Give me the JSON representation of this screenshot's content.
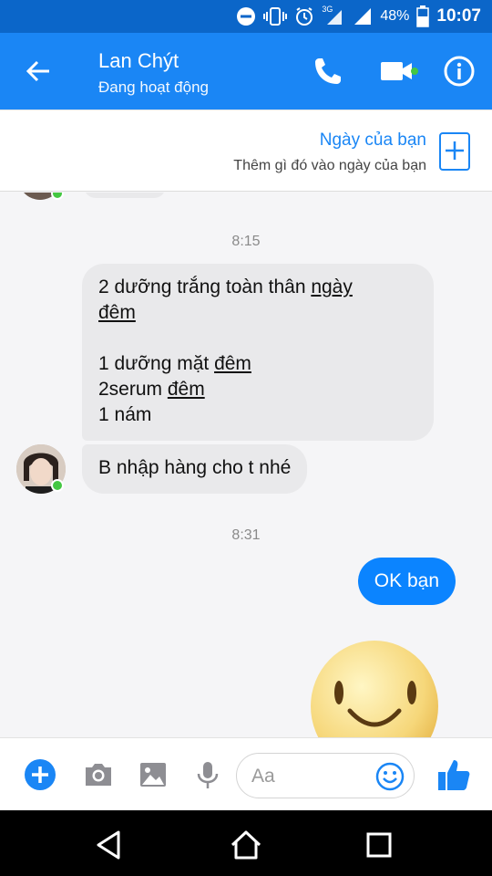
{
  "status_bar": {
    "network_label": "3G",
    "battery": "48%",
    "time": "10:07"
  },
  "header": {
    "contact_name": "Lan Chýt",
    "contact_status": "Đang hoạt động"
  },
  "your_day": {
    "title": "Ngày của bạn",
    "subtitle": "Thêm gì đó vào ngày của bạn"
  },
  "conversation": {
    "timestamp_1": "8:15",
    "message_1": {
      "line1_part1": "2 dưỡng trắng toàn thân ",
      "line1_link": "ngày",
      "line2_link": "đêm",
      "line3_part1": "1 dưỡng mặt ",
      "line3_link": "đêm",
      "line4_part1": "2serum ",
      "line4_link": "đêm",
      "line5": "1 nám"
    },
    "message_2": "B nhập hàng cho t nhé",
    "timestamp_2": "8:31",
    "message_3": "OK bạn"
  },
  "composer": {
    "placeholder": "Aa"
  },
  "colors": {
    "brand_blue": "#1a86f5",
    "status_blue": "#0b66c9",
    "outgoing_bubble": "#0b84ff",
    "incoming_bubble": "#e9e9eb",
    "online_green": "#44c742"
  }
}
